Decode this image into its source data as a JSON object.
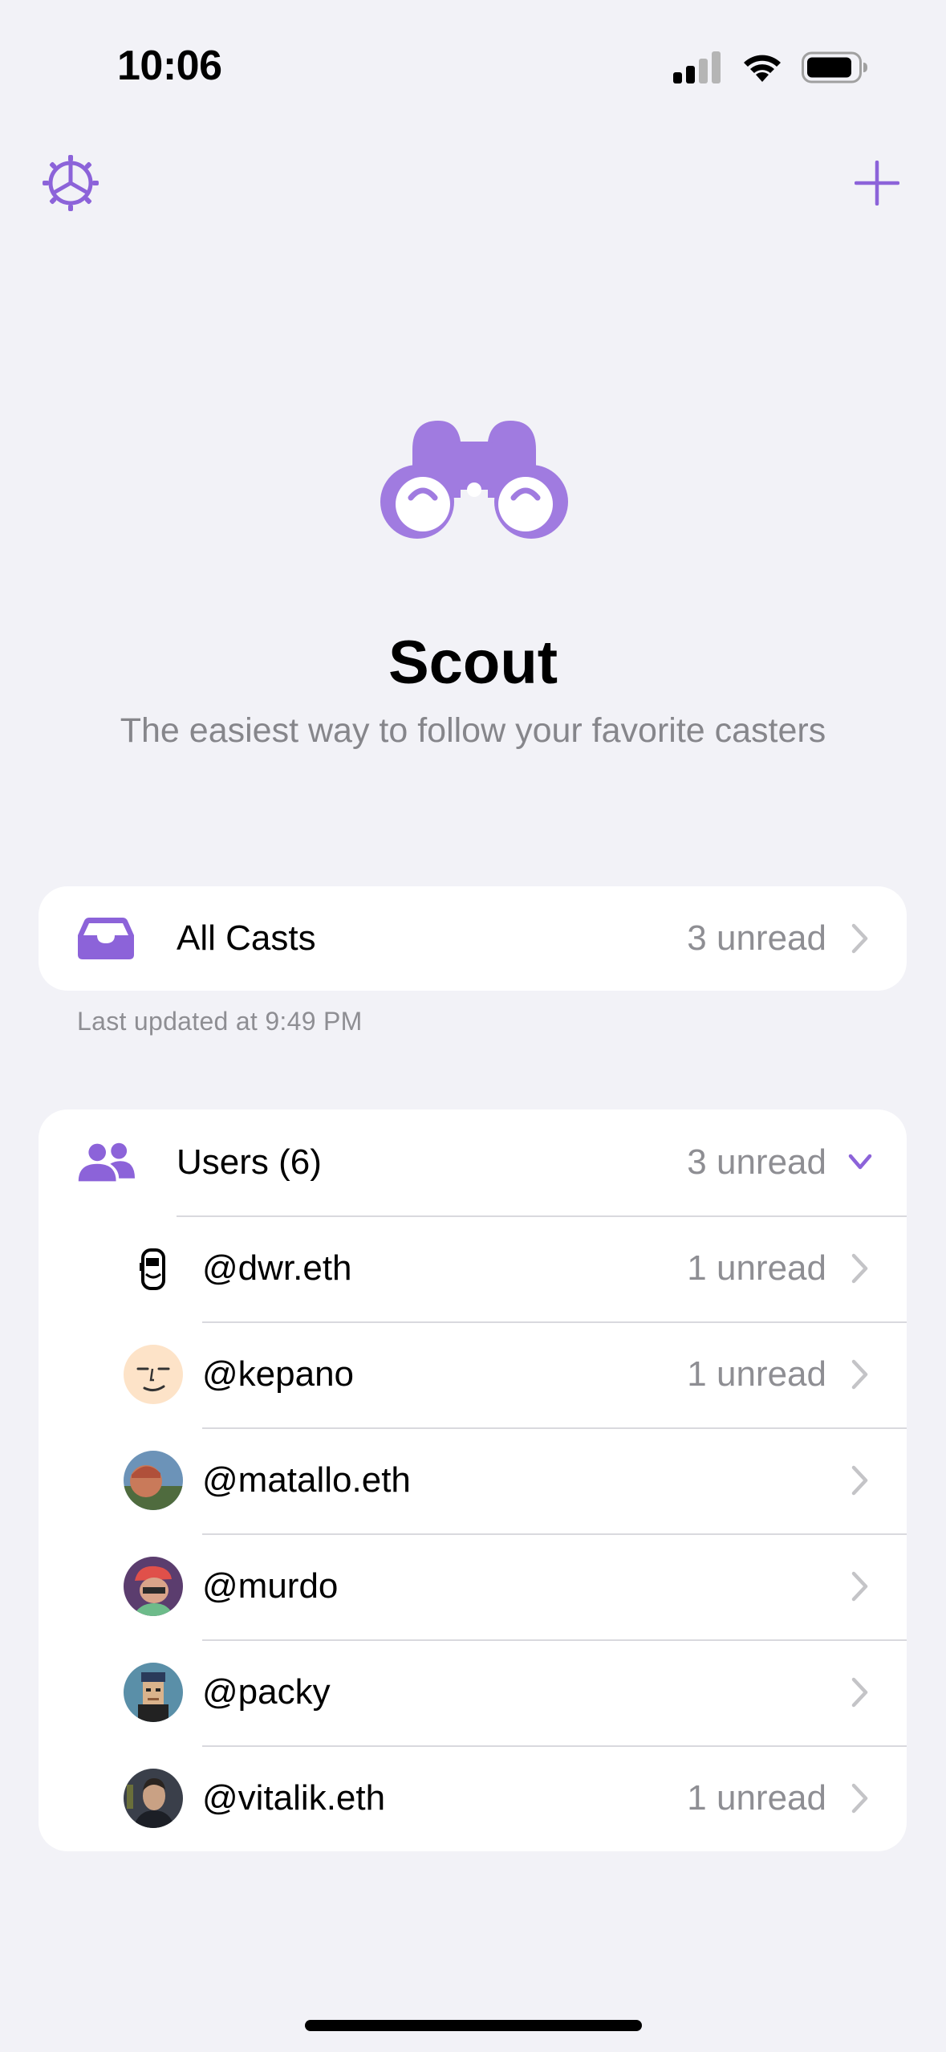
{
  "status_bar": {
    "time": "10:06",
    "icons": [
      "cellular-signal-icon",
      "wifi-icon",
      "battery-icon"
    ]
  },
  "nav": {
    "left_icon": "settings-gear-icon",
    "right_icon": "plus-icon"
  },
  "hero": {
    "icon": "binoculars-icon",
    "title": "Scout",
    "subtitle": "The easiest way to follow your favorite casters"
  },
  "all_casts": {
    "icon": "inbox-tray-icon",
    "label": "All Casts",
    "detail": "3 unread",
    "footnote": "Last updated at 9:49 PM"
  },
  "users": {
    "icon": "people-icon",
    "label": "Users (6)",
    "detail": "3 unread",
    "items": [
      {
        "handle": "@dwr.eth",
        "detail": "1 unread",
        "avatar": "avatar-dwr"
      },
      {
        "handle": "@kepano",
        "detail": "1 unread",
        "avatar": "avatar-kepano"
      },
      {
        "handle": "@matallo.eth",
        "detail": "",
        "avatar": "avatar-matallo"
      },
      {
        "handle": "@murdo",
        "detail": "",
        "avatar": "avatar-murdo"
      },
      {
        "handle": "@packy",
        "detail": "",
        "avatar": "avatar-packy"
      },
      {
        "handle": "@vitalik.eth",
        "detail": "1 unread",
        "avatar": "avatar-vitalik"
      }
    ]
  },
  "colors": {
    "accent": "#8c63d9",
    "background": "#f2f2f7",
    "secondary_text": "#8e8e93",
    "separator": "#d9d9de"
  }
}
